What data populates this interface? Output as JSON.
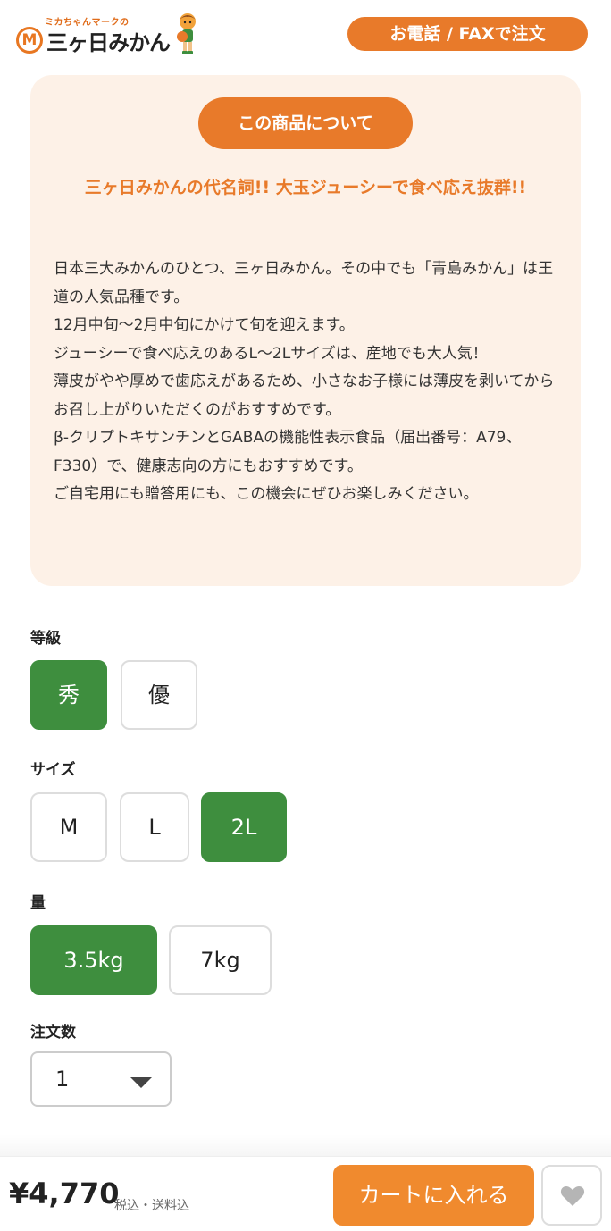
{
  "header": {
    "logo_small": "ミカちゃんマークの",
    "logo_badge": "M",
    "logo_main": "三ヶ日みかん",
    "phone_fax_label": "お電話 / FAXで注文"
  },
  "about": {
    "pill_label": "この商品について",
    "headline": "三ヶ日みかんの代名詞!! 大玉ジューシーで食べ応え抜群!!",
    "body_lines": [
      "日本三大みかんのひとつ、三ヶ日みかん。その中でも「青島みかん」は王道の人気品種です。",
      "12月中旬〜2月中旬にかけて旬を迎えます。",
      "ジューシーで食べ応えのあるL〜2Lサイズは、産地でも大人気！",
      "薄皮がやや厚めで歯応えがあるため、小さなお子様には薄皮を剥いてからお召し上がりいただくのがおすすめです。",
      "β-クリプトキサンチンとGABAの機能性表示食品（届出番号：A79、F330）で、健康志向の方にもおすすめです。",
      "ご自宅用にも贈答用にも、この機会にぜひお楽しみください。"
    ]
  },
  "grade": {
    "label": "等級",
    "options": [
      "秀",
      "優"
    ],
    "selected": "秀"
  },
  "size": {
    "label": "サイズ",
    "options": [
      "M",
      "L",
      "2L"
    ],
    "selected": "2L"
  },
  "amount": {
    "label": "量",
    "options": [
      "3.5kg",
      "7kg"
    ],
    "selected": "3.5kg"
  },
  "quantity": {
    "label": "注文数",
    "value": "1"
  },
  "footer": {
    "price": "¥4,770",
    "price_note": "税込・送料込",
    "cart_label": "カートに入れる",
    "favorite_icon": "heart-icon"
  },
  "colors": {
    "accent_orange": "#e87a2a",
    "selected_green": "#3e8e3e",
    "about_bg": "#fdf1e7"
  }
}
